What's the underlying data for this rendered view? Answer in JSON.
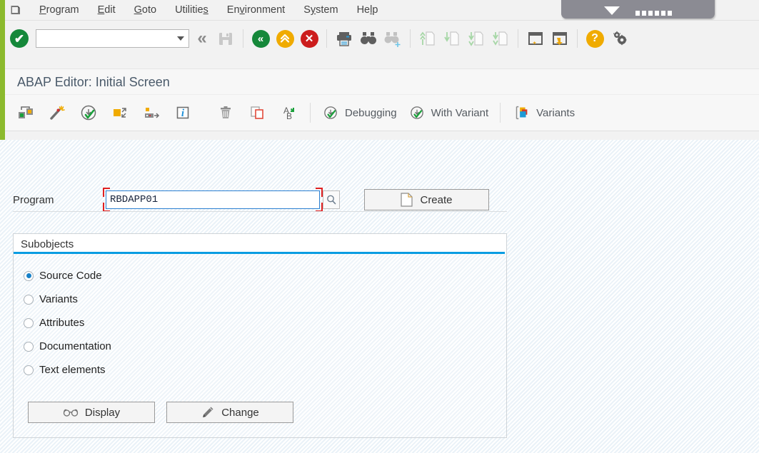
{
  "menu": {
    "system_icon": "sap-menu-icon",
    "items": [
      {
        "label": "Program",
        "accel": "P"
      },
      {
        "label": "Edit",
        "accel": "E"
      },
      {
        "label": "Goto",
        "accel": "G"
      },
      {
        "label": "Utilities",
        "accel": "s"
      },
      {
        "label": "Environment",
        "accel": "v"
      },
      {
        "label": "System",
        "accel": "y"
      },
      {
        "label": "Help",
        "accel": "l"
      }
    ]
  },
  "toolbar": {
    "ok_label": "✔",
    "command_value": "",
    "command_placeholder": "",
    "back_label": "«",
    "save_label": "save-disk",
    "green_back_label": "«",
    "orange_up_label": "˄",
    "red_cancel_label": "✕",
    "help_label": "?",
    "buttons": [
      "ok-check",
      "command-field",
      "back",
      "save",
      "back-green",
      "exit-up",
      "cancel",
      "print",
      "find",
      "find-next",
      "first-page",
      "previous-page",
      "next-page",
      "last-page",
      "create-session",
      "create-shortcut",
      "help",
      "customize"
    ]
  },
  "title": "ABAP Editor: Initial Screen",
  "appbar": {
    "icon_buttons": [
      "object-navigator-icon",
      "wand-icon",
      "check-execute-icon",
      "other-object-icon",
      "generate-icon",
      "info-icon",
      "delete-icon",
      "copy-icon",
      "rename-icon"
    ],
    "text_buttons": [
      {
        "label": "Debugging",
        "icon": "debug-execute-icon"
      },
      {
        "label": "With Variant",
        "icon": "variant-execute-icon"
      },
      {
        "label": "Variants",
        "icon": "variants-icon"
      }
    ]
  },
  "form": {
    "program_label": "Program",
    "program_value": "RBDAPP01",
    "value_help_icon": "search-magnifier-icon",
    "create_label": "Create",
    "create_icon": "new-document-icon"
  },
  "subobjects": {
    "title": "Subobjects",
    "options": [
      {
        "label": "Source Code",
        "selected": true
      },
      {
        "label": "Variants",
        "selected": false
      },
      {
        "label": "Attributes",
        "selected": false
      },
      {
        "label": "Documentation",
        "selected": false
      },
      {
        "label": "Text elements",
        "selected": false
      }
    ],
    "display_label": "Display",
    "display_icon": "glasses-icon",
    "change_label": "Change",
    "change_icon": "pencil-icon"
  },
  "colors": {
    "brand_green": "#8cba2d",
    "accent_blue": "#0a9de2",
    "focus_blue": "#2b7fd1",
    "marker_red": "#e02020",
    "ok_green": "#15883a",
    "warn_orange": "#f0ab00",
    "error_red": "#cc1d1d"
  }
}
